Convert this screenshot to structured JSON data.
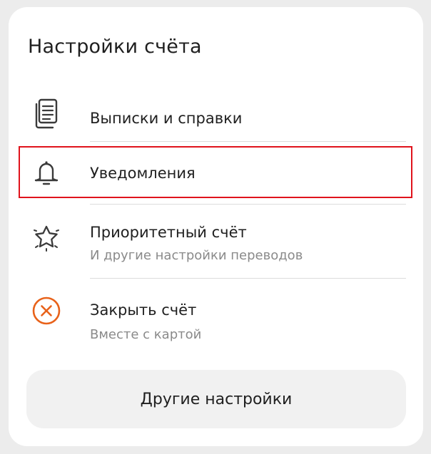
{
  "header": {
    "title": "Настройки счёта"
  },
  "items": [
    {
      "label": "Выписки и справки",
      "icon": "documents-icon"
    },
    {
      "label": "Уведомления",
      "icon": "bell-icon"
    },
    {
      "label": "Приоритетный счёт",
      "sublabel": "И другие настройки переводов",
      "icon": "star-icon"
    },
    {
      "label": "Закрыть счёт",
      "sublabel": "Вместе с картой",
      "icon": "close-circle-icon"
    }
  ],
  "footer": {
    "button_label": "Другие настройки"
  },
  "colors": {
    "accent_orange": "#e8621a",
    "highlight_red": "#e0131c",
    "icon_gray": "#3a3a3a"
  }
}
